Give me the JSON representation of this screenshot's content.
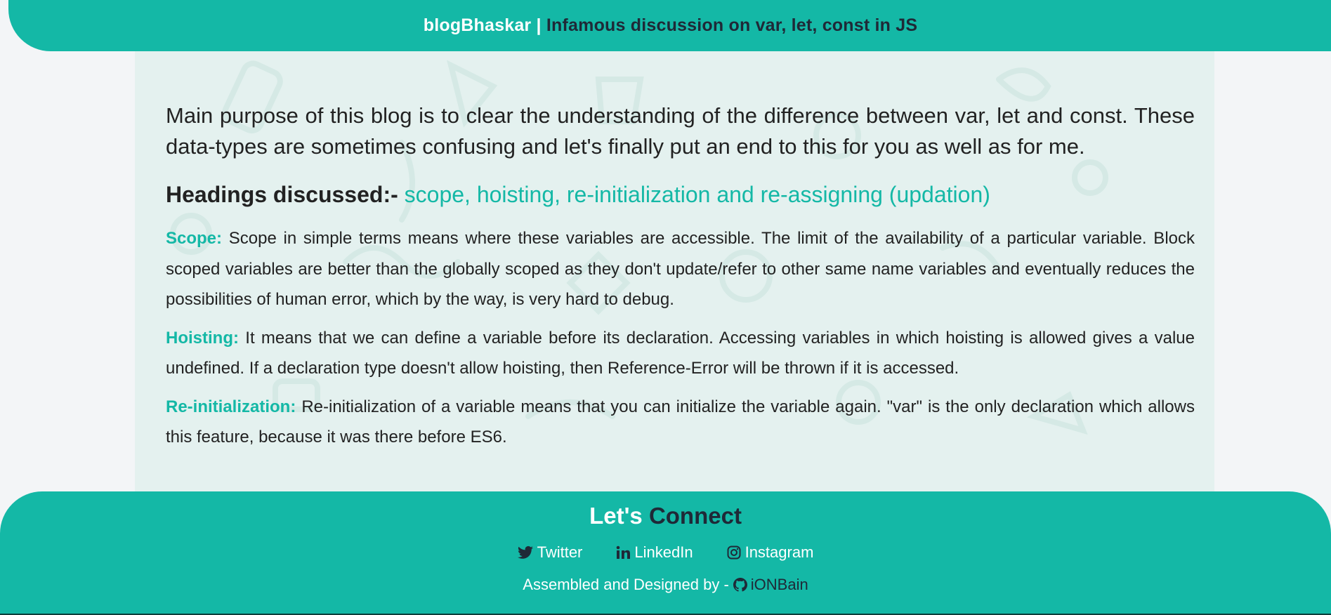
{
  "header": {
    "brand": "blogBhaskar",
    "separator": "|",
    "topic": "Infamous discussion on var, let, const in JS"
  },
  "article": {
    "intro": "Main purpose of this blog is to clear the understanding of the difference between var, let and const. These data-types are sometimes confusing and let's finally put an end to this for you as well as for me.",
    "headings_label": "Headings discussed:-",
    "headings_list": "scope, hoisting, re-initialization and re-assigning (updation)",
    "sections": [
      {
        "term": "Scope:",
        "text": "Scope in simple terms means where these variables are accessible. The limit of the availability of a particular variable. Block scoped variables are better than the globally scoped as they don't update/refer to other same name variables and eventually reduces the possibilities of human error, which by the way, is very hard to debug."
      },
      {
        "term": "Hoisting:",
        "text": "It means that we can define a variable before its declaration. Accessing variables in which hoisting is allowed gives a value undefined. If a declaration type doesn't allow hoisting, then Reference-Error will be thrown if it is accessed."
      },
      {
        "term": "Re-initialization:",
        "text": "Re-initialization of a variable means that you can initialize the variable again. \"var\" is the only declaration which allows this feature, because it was there before ES6."
      }
    ]
  },
  "footer": {
    "title_part1": "Let's",
    "title_part2": "Connect",
    "socials": [
      {
        "label": "Twitter",
        "icon": "twitter-icon"
      },
      {
        "label": "LinkedIn",
        "icon": "linkedin-icon"
      },
      {
        "label": "Instagram",
        "icon": "instagram-icon"
      }
    ],
    "credit_prefix": "Assembled and Designed by -",
    "author": "iONBain",
    "author_icon": "github-icon"
  },
  "colors": {
    "accent": "#14b8a6",
    "dark_text": "#1f2937",
    "content_bg": "#e4f1ef"
  }
}
